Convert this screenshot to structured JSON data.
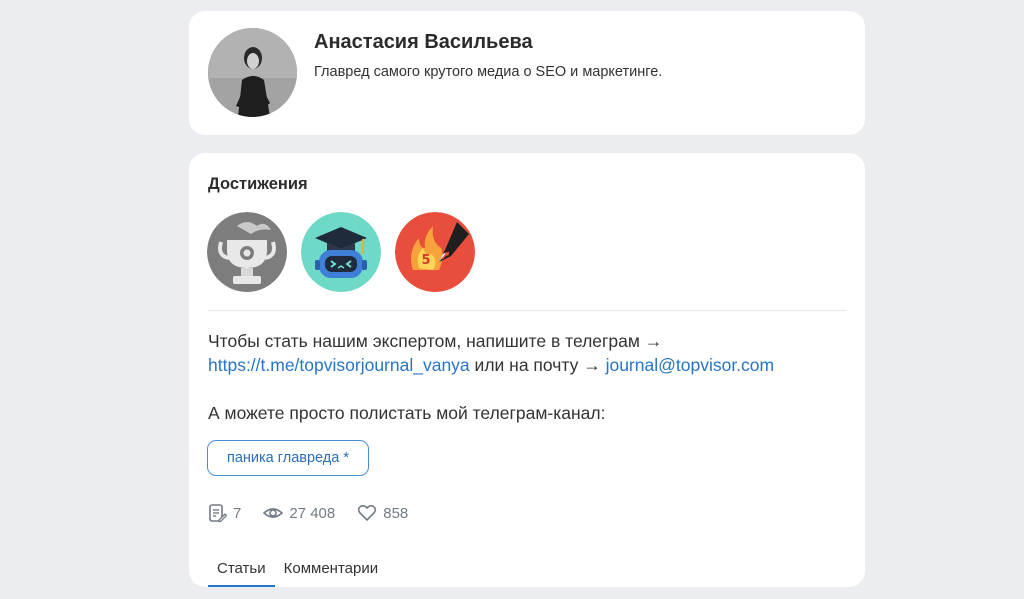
{
  "profile": {
    "name": "Анастасия Васильева",
    "bio": "Главред самого крутого медиа о SEO и маркетинге."
  },
  "achievements": {
    "title": "Достижения",
    "badges": [
      {
        "icon": "trophy-icon",
        "color": "#7a7a7a"
      },
      {
        "icon": "graduate-robot-icon",
        "color": "#6fd9c8"
      },
      {
        "icon": "fire-pen-icon",
        "color": "#e94e3c",
        "number": "5"
      }
    ]
  },
  "info": {
    "line1_prefix": "Чтобы стать нашим экспертом, напишите в телеграм →",
    "telegram_link": "https://t.me/topvisorjournal_vanya",
    "line2_middle": "или на почту →",
    "email_link": "journal@topvisor.com",
    "channel_text": "А можете просто полистать мой телеграм-канал:",
    "channel_tag": "паника главреда *"
  },
  "stats": {
    "articles": "7",
    "views": "27 408",
    "likes": "858"
  },
  "tabs": [
    {
      "label": "Статьи",
      "active": true
    },
    {
      "label": "Комментарии",
      "active": false
    }
  ],
  "colors": {
    "link": "#2775c5",
    "background": "#ebedf0",
    "card": "#ffffff"
  }
}
